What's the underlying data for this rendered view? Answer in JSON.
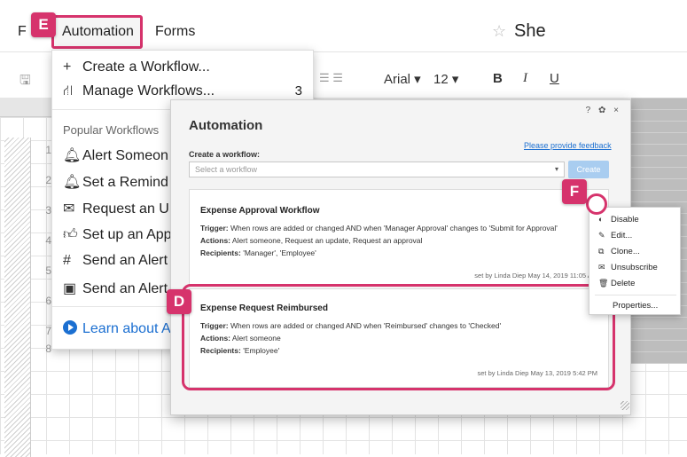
{
  "menubar": {
    "file_label": "F",
    "automation_label": "Automation",
    "forms_label": "Forms",
    "sheet_title": "She"
  },
  "toolbar": {
    "font_name": "Arial ▾",
    "font_size": "12 ▾",
    "bold": "B",
    "italic": "I",
    "underline": "U"
  },
  "grid": {
    "row_numbers": [
      "1",
      "2",
      "3",
      "4",
      "5",
      "6",
      "7",
      "8"
    ]
  },
  "dropdown": {
    "create_workflow": "Create a Workflow...",
    "manage_workflows": "Manage Workflows...",
    "manage_count": "3",
    "section_title": "Popular Workflows",
    "items": [
      "Alert Someon",
      "Set a Remind",
      "Request an U",
      "Set up an App",
      "Send an Alert",
      "Send an Alert"
    ],
    "learn_link": "Learn about A"
  },
  "badges": {
    "e": "E",
    "f": "F",
    "d": "D"
  },
  "dialog": {
    "title": "Automation",
    "controls": "? ✿ ×",
    "feedback_link": "Please provide feedback",
    "create_label": "Create a workflow:",
    "select_placeholder": "Select a workflow",
    "create_button": "Create",
    "workflows": [
      {
        "title": "Expense Approval Workflow",
        "trigger_label": "Trigger:",
        "trigger": " When rows are added or changed AND when 'Manager Approval' changes to 'Submit for Approval'",
        "actions_label": "Actions:",
        "actions": " Alert someone, Request an update, Request an approval",
        "recipients_label": "Recipients:",
        "recipients": " 'Manager', 'Employee'",
        "meta": "set by Linda Diep  May 14, 2019 11:05 AM"
      },
      {
        "title": "Expense Request Reimbursed",
        "trigger_label": "Trigger:",
        "trigger": " When rows are added or changed AND when 'Reimbursed' changes to 'Checked'",
        "actions_label": "Actions:",
        "actions": " Alert someone",
        "recipients_label": "Recipients:",
        "recipients": " 'Employee'",
        "meta": "set by Linda Diep  May 13, 2019 5:42 PM"
      }
    ]
  },
  "context_menu": {
    "items": [
      "Disable",
      "Edit...",
      "Clone...",
      "Unsubscribe",
      "Delete",
      "Properties..."
    ]
  },
  "colors": {
    "highlight": "#d6336c",
    "link": "#1b6fd1",
    "button_disabled": "#a9cdf0"
  }
}
